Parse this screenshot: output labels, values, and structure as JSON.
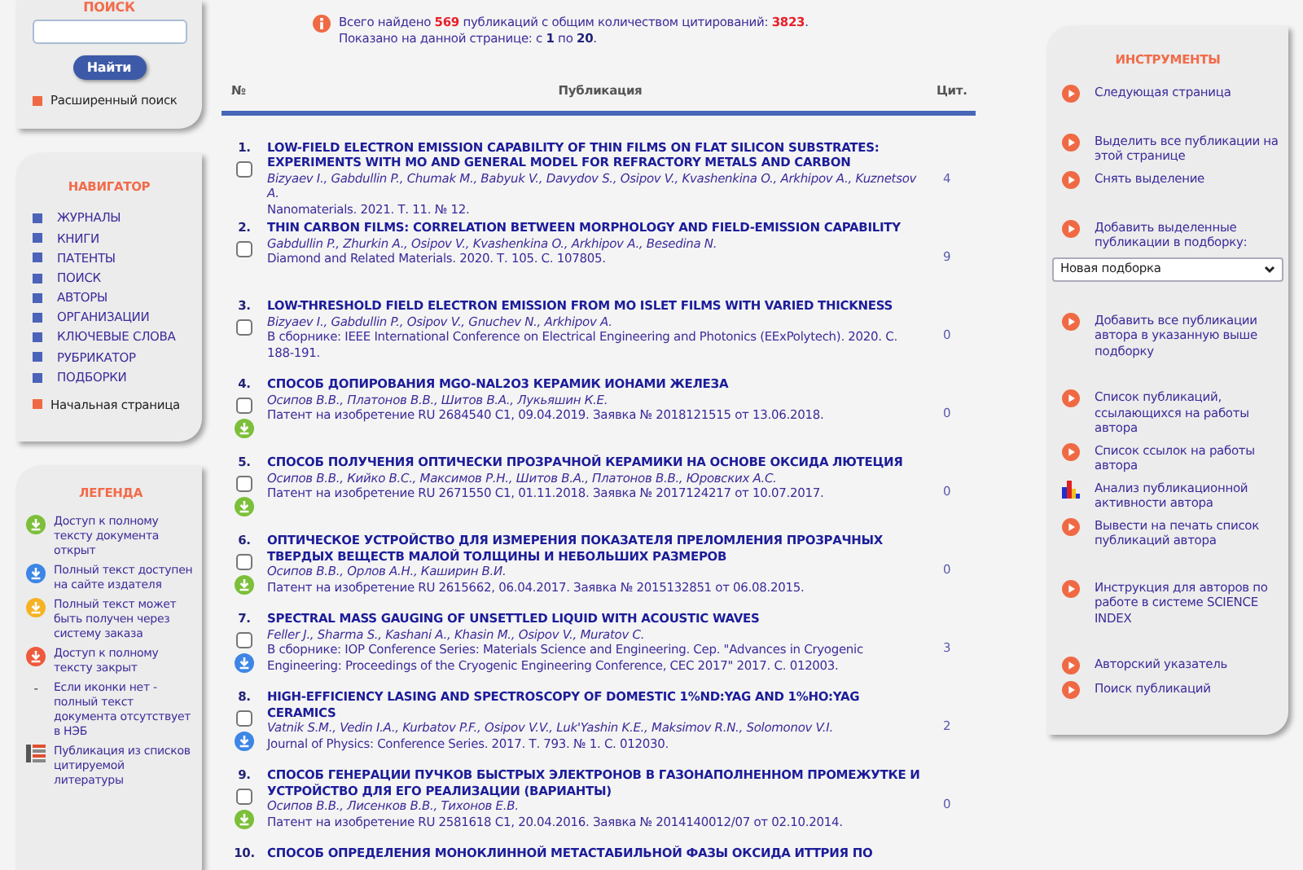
{
  "search_panel": {
    "title": "ПОИСК",
    "button": "Найти",
    "advanced_link": "Расширенный поиск"
  },
  "navigator": {
    "title": "НАВИГАТОР",
    "items": [
      "ЖУРНАЛЫ",
      "КНИГИ",
      "ПАТЕНТЫ",
      "ПОИСК",
      "АВТОРЫ",
      "ОРГАНИЗАЦИИ",
      "КЛЮЧЕВЫЕ СЛОВА",
      "РУБРИКАТОР",
      "ПОДБОРКИ"
    ],
    "home_link": "Начальная страница"
  },
  "legend": {
    "title": "ЛЕГЕНДА",
    "items": [
      {
        "kind": "open",
        "text": "Доступ к полному тексту документа открыт"
      },
      {
        "kind": "publisher",
        "text": "Полный текст доступен на сайте издателя"
      },
      {
        "kind": "order",
        "text": "Полный текст может быть получен через систему заказа"
      },
      {
        "kind": "closed",
        "text": "Доступ к полному тексту закрыт"
      },
      {
        "kind": "none",
        "mark": "-",
        "text": "Если иконки нет - полный текст документа отсутствует в НЭБ"
      },
      {
        "kind": "cited",
        "text": "Публикация из списков цитируемой литературы"
      }
    ]
  },
  "summary": {
    "lines": [
      [
        {
          "kind": "plain",
          "text": "Всего найдено "
        },
        {
          "kind": "red",
          "text": "569"
        },
        {
          "kind": "plain",
          "text": " публикаций с общим количеством цитирований: "
        },
        {
          "kind": "red",
          "text": "3823"
        },
        {
          "kind": "plain",
          "text": "."
        }
      ],
      [
        {
          "kind": "plain",
          "text": "Показано на данной странице: с "
        },
        {
          "kind": "bold",
          "text": "1"
        },
        {
          "kind": "plain",
          "text": " по "
        },
        {
          "kind": "bold",
          "text": "20"
        },
        {
          "kind": "plain",
          "text": "."
        }
      ]
    ]
  },
  "table": {
    "columns": [
      "№",
      "Публикация",
      "Цит."
    ],
    "rows": [
      {
        "number": "1.",
        "checked": false,
        "title": "LOW-FIELD ELECTRON EMISSION CAPABILITY OF THIN FILMS ON FLAT SILICON SUBSTRATES: EXPERIMENTS WITH MO AND GENERAL MODEL FOR REFRACTORY METALS AND CARBON",
        "authors": "Bizyaev I., Gabdullin P., Chumak M., Babyuk V., Davydov S., Osipov V., Kvashenkina O., Arkhipov A., Kuznetsov A.",
        "source": "Nanomaterials. 2021. Т. 11. № 12.",
        "citations": "4"
      },
      {
        "number": "2.",
        "checked": false,
        "title": "THIN CARBON FILMS: CORRELATION BETWEEN MORPHOLOGY AND FIELD-EMISSION CAPABILITY",
        "authors": "Gabdullin P., Zhurkin A., Osipov V., Kvashenkina O., Arkhipov A., Besedina N.",
        "source": "Diamond and Related Materials. 2020. Т. 105. С. 107805.",
        "citations": "9"
      },
      {
        "number": "3.",
        "checked": false,
        "title": "LOW-THRESHOLD FIELD ELECTRON EMISSION FROM MO ISLET FILMS WITH VARIED THICKNESS",
        "authors": "Bizyaev I., Gabdullin P., Osipov V., Gnuchev N., Arkhipov A.",
        "source": "В сборнике: IEEE International Conference on Electrical Engineering and Photonics (EExPolytech). 2020. С. 188-191.",
        "citations": "0"
      },
      {
        "number": "4.",
        "checked": false,
        "title": "СПОСОБ ДОПИРОВАНИЯ MGO-NAL2O3 КЕРАМИК ИОНАМИ ЖЕЛЕЗА",
        "authors": "Осипов В.В., Платонов В.В., Шитов В.А., Лукьяшин К.Е.",
        "source": "Патент на изобретение RU 2684540 C1, 09.04.2019. Заявка № 2018121515 от 13.06.2018.",
        "citations": "0",
        "kind": "open"
      },
      {
        "number": "5.",
        "checked": false,
        "title": "СПОСОБ ПОЛУЧЕНИЯ ОПТИЧЕСКИ ПРОЗРАЧНОЙ КЕРАМИКИ НА ОСНОВЕ ОКСИДА ЛЮТЕЦИЯ",
        "authors": "Осипов В.В., Кийко В.С., Максимов Р.Н., Шитов В.А., Платонов В.В., Юровских А.С.",
        "source": "Патент на изобретение RU 2671550 C1, 01.11.2018. Заявка № 2017124217 от 10.07.2017.",
        "citations": "0",
        "kind": "open"
      },
      {
        "number": "6.",
        "checked": false,
        "title": "ОПТИЧЕСКОЕ УСТРОЙСТВО ДЛЯ ИЗМЕРЕНИЯ ПОКАЗАТЕЛЯ ПРЕЛОМЛЕНИЯ ПРОЗРАЧНЫХ ТВЕРДЫХ ВЕЩЕСТВ МАЛОЙ ТОЛЩИНЫ И НЕБОЛЬШИХ РАЗМЕРОВ",
        "authors": "Осипов В.В., Орлов А.Н., Каширин В.И.",
        "source": "Патент на изобретение RU 2615662, 06.04.2017. Заявка № 2015132851 от 06.08.2015.",
        "citations": "0",
        "kind": "open"
      },
      {
        "number": "7.",
        "checked": false,
        "title": "SPECTRAL MASS GAUGING OF UNSETTLED LIQUID WITH ACOUSTIC WAVES",
        "authors": "Feller J., Sharma S., Kashani A., Khasin M., Osipov V., Muratov C.",
        "source": "В сборнике: IOP Conference Series: Materials Science and Engineering. Сер. \"Advances in Cryogenic Engineering: Proceedings of the Cryogenic Engineering Conference, CEC 2017\" 2017. С. 012003.",
        "citations": "3",
        "kind": "publisher"
      },
      {
        "number": "8.",
        "checked": false,
        "title": "HIGH-EFFICIENCY LASING AND SPECTROSCOPY OF DOMESTIC 1%ND:YAG AND 1%HO:YAG CERAMICS",
        "authors": "Vatnik S.M., Vedin I.A., Kurbatov P.F., Osipov V.V., Luk'Yashin K.E., Maksimov R.N., Solomonov V.I.",
        "source": "Journal of Physics: Conference Series. 2017. Т. 793. № 1. С. 012030.",
        "citations": "2",
        "kind": "publisher"
      },
      {
        "number": "9.",
        "checked": false,
        "title": "СПОСОБ ГЕНЕРАЦИИ ПУЧКОВ БЫСТРЫХ ЭЛЕКТРОНОВ В ГАЗОНАПОЛНЕННОМ ПРОМЕЖУТКЕ И УСТРОЙСТВО ДЛЯ ЕГО РЕАЛИЗАЦИИ (ВАРИАНТЫ)",
        "authors": "Осипов В.В., Лисенков В.В., Тихонов Е.В.",
        "source": "Патент на изобретение RU 2581618 C1, 20.04.2016. Заявка № 2014140012/07 от 02.10.2014.",
        "citations": "0",
        "kind": "open"
      },
      {
        "number": "10.",
        "title": "СПОСОБ ОПРЕДЕЛЕНИЯ МОНОКЛИННОЙ МЕТАСТАБИЛЬНОЙ ФАЗЫ ОКСИДА ИТТРИЯ ПО"
      }
    ]
  },
  "tools": {
    "title": "ИНСТРУМЕНТЫ",
    "groups": [
      [
        {
          "kind": "play",
          "text": "Следующая страница"
        }
      ],
      [
        {
          "kind": "play",
          "text": "Выделить все публикации на этой странице"
        },
        {
          "kind": "play",
          "text": "Снять выделение"
        }
      ],
      [
        {
          "kind": "play",
          "text": "Добавить выделенные публикации в подборку:"
        },
        {
          "kind": "select",
          "value": "Новая подборка"
        }
      ],
      [
        {
          "kind": "play",
          "text": "Добавить все публикации автора в указанную выше подборку"
        }
      ],
      [
        {
          "kind": "play",
          "text": "Список публикаций, ссылающихся на работы автора"
        },
        {
          "kind": "play",
          "text": "Список ссылок на работы автора"
        },
        {
          "kind": "chart",
          "text": "Анализ публикационной активности автора"
        },
        {
          "kind": "play",
          "text": "Вывести на печать список публикаций автора"
        }
      ],
      [
        {
          "kind": "play",
          "text": "Инструкция для авторов по работе в системе SCIENCE INDEX"
        }
      ],
      [
        {
          "kind": "play",
          "text": "Авторский указатель"
        },
        {
          "kind": "play",
          "text": "Поиск публикаций"
        }
      ]
    ]
  }
}
